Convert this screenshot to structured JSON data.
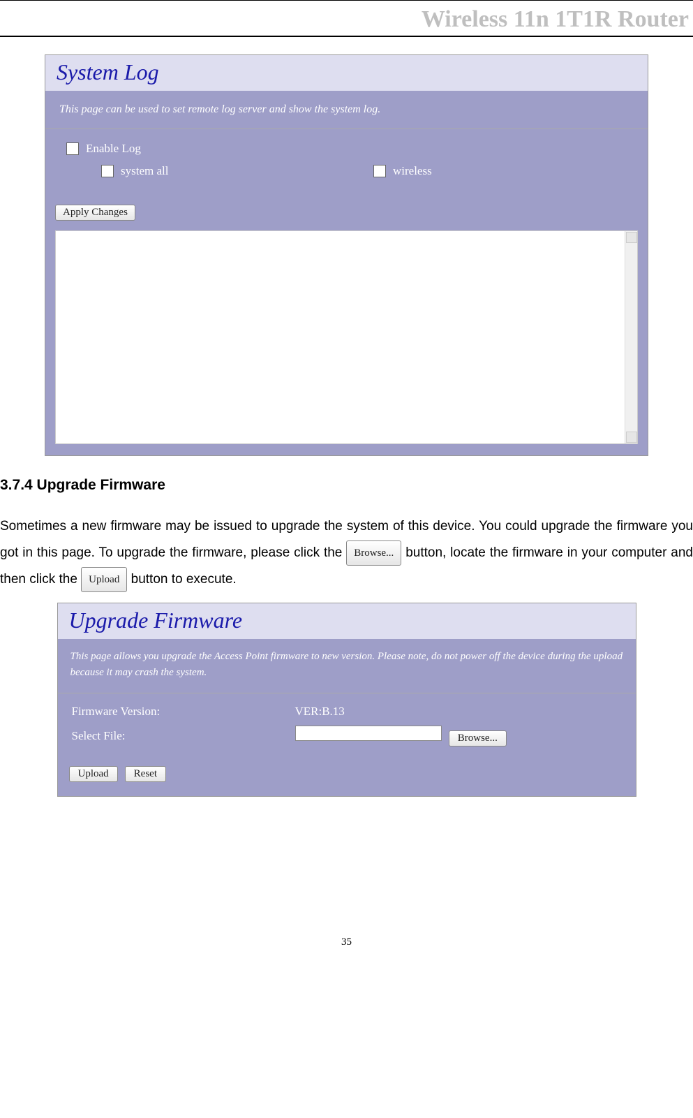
{
  "header": {
    "title": "Wireless 11n 1T1R Router"
  },
  "syslog": {
    "title": "System Log",
    "subtitle": "This page can be used to set remote log server and show the system log.",
    "enable_label": "Enable Log",
    "system_all_label": "system all",
    "wireless_label": "wireless",
    "apply_label": "Apply Changes"
  },
  "section": {
    "heading": "3.7.4 Upgrade Firmware",
    "para_before_browse": "Sometimes a new firmware may be issued to upgrade the system of this device. You could upgrade the firmware you got in this page. To upgrade the firmware, please click the ",
    "para_after_browse": " button, locate the firmware in your computer and then click the ",
    "para_after_upload": " button to execute.",
    "browse_label": "Browse...",
    "upload_label": "Upload"
  },
  "upgrade": {
    "title": "Upgrade Firmware",
    "subtitle": "This page allows you upgrade the Access Point firmware to new version. Please note, do not power off the device during the upload because it may crash the system.",
    "fw_version_label": "Firmware Version:",
    "fw_version_value": "VER:B.13",
    "select_file_label": "Select File:",
    "browse_label": "Browse...",
    "upload_label": "Upload",
    "reset_label": "Reset"
  },
  "page_number": "35"
}
